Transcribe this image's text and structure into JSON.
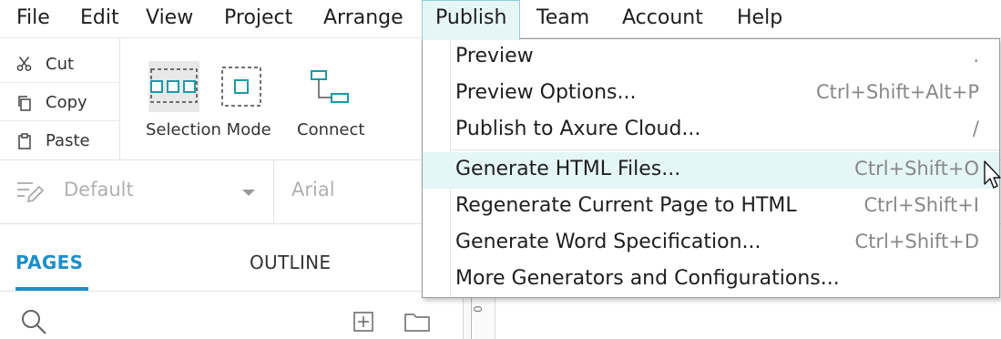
{
  "menubar": {
    "items": [
      "File",
      "Edit",
      "View",
      "Project",
      "Arrange",
      "Publish",
      "Team",
      "Account",
      "Help"
    ],
    "active": "Publish"
  },
  "clipboard": {
    "cut": "Cut",
    "copy": "Copy",
    "paste": "Paste"
  },
  "toolbar": {
    "selection_mode": "Selection Mode",
    "connect": "Connect"
  },
  "style": {
    "style_name": "Default",
    "font": "Arial"
  },
  "panel": {
    "tab_pages": "PAGES",
    "tab_outline": "OUTLINE"
  },
  "publish_menu": {
    "items": [
      {
        "label": "Preview",
        "shortcut": "."
      },
      {
        "label": "Preview Options...",
        "shortcut": "Ctrl+Shift+Alt+P"
      },
      {
        "label": "Publish to Axure Cloud...",
        "shortcut": "/"
      },
      {
        "label": "Generate HTML Files...",
        "shortcut": "Ctrl+Shift+O"
      },
      {
        "label": "Regenerate Current Page to HTML",
        "shortcut": "Ctrl+Shift+I"
      },
      {
        "label": "Generate Word Specification...",
        "shortcut": "Ctrl+Shift+D"
      },
      {
        "label": "More Generators and Configurations...",
        "shortcut": ""
      }
    ],
    "hovered": "Generate HTML Files..."
  },
  "colors": {
    "accent": "#1c8fc8",
    "icon_teal": "#1b9aa8",
    "hover_bg": "#e4f6f6"
  },
  "ruler": {
    "tick": "0"
  }
}
